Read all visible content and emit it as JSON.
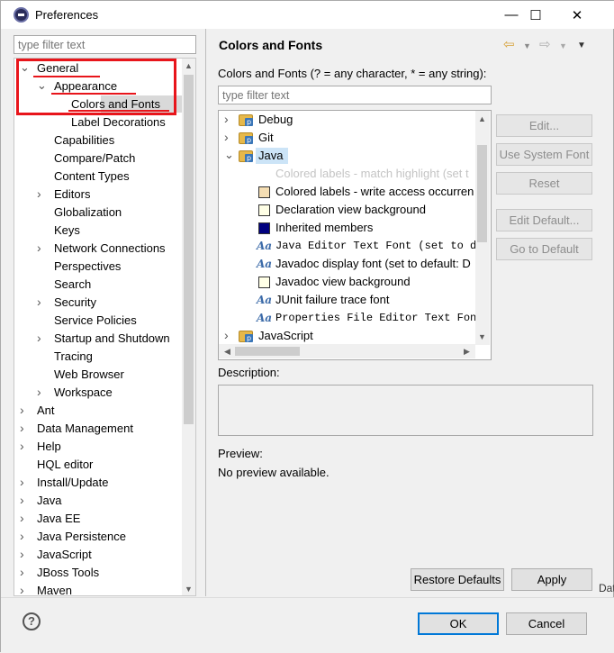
{
  "window": {
    "title": "Preferences",
    "minimize": "—",
    "maximize": "☐",
    "close": "✕"
  },
  "left": {
    "filter_placeholder": "type filter text",
    "tree": [
      {
        "label": "General",
        "indent": 0,
        "expander": "v",
        "id": "general"
      },
      {
        "label": "Appearance",
        "indent": 1,
        "expander": "v",
        "id": "appearance"
      },
      {
        "label": "Colors and Fonts",
        "indent": 2,
        "expander": "",
        "id": "colors-and-fonts",
        "selected": true
      },
      {
        "label": "Label Decorations",
        "indent": 2,
        "expander": "",
        "id": "label-decorations"
      },
      {
        "label": "Capabilities",
        "indent": 1,
        "expander": "",
        "id": "capabilities"
      },
      {
        "label": "Compare/Patch",
        "indent": 1,
        "expander": "",
        "id": "compare-patch"
      },
      {
        "label": "Content Types",
        "indent": 1,
        "expander": "",
        "id": "content-types"
      },
      {
        "label": "Editors",
        "indent": 1,
        "expander": ">",
        "id": "editors"
      },
      {
        "label": "Globalization",
        "indent": 1,
        "expander": "",
        "id": "globalization"
      },
      {
        "label": "Keys",
        "indent": 1,
        "expander": "",
        "id": "keys"
      },
      {
        "label": "Network Connections",
        "indent": 1,
        "expander": ">",
        "id": "network-connections"
      },
      {
        "label": "Perspectives",
        "indent": 1,
        "expander": "",
        "id": "perspectives"
      },
      {
        "label": "Search",
        "indent": 1,
        "expander": "",
        "id": "search"
      },
      {
        "label": "Security",
        "indent": 1,
        "expander": ">",
        "id": "security"
      },
      {
        "label": "Service Policies",
        "indent": 1,
        "expander": "",
        "id": "service-policies"
      },
      {
        "label": "Startup and Shutdown",
        "indent": 1,
        "expander": ">",
        "id": "startup-and-shutdown"
      },
      {
        "label": "Tracing",
        "indent": 1,
        "expander": "",
        "id": "tracing"
      },
      {
        "label": "Web Browser",
        "indent": 1,
        "expander": "",
        "id": "web-browser"
      },
      {
        "label": "Workspace",
        "indent": 1,
        "expander": ">",
        "id": "workspace"
      },
      {
        "label": "Ant",
        "indent": 0,
        "expander": ">",
        "id": "ant"
      },
      {
        "label": "Data Management",
        "indent": 0,
        "expander": ">",
        "id": "data-management"
      },
      {
        "label": "Help",
        "indent": 0,
        "expander": ">",
        "id": "help"
      },
      {
        "label": "HQL editor",
        "indent": 0,
        "expander": "",
        "id": "hql-editor"
      },
      {
        "label": "Install/Update",
        "indent": 0,
        "expander": ">",
        "id": "install-update"
      },
      {
        "label": "Java",
        "indent": 0,
        "expander": ">",
        "id": "java"
      },
      {
        "label": "Java EE",
        "indent": 0,
        "expander": ">",
        "id": "java-ee"
      },
      {
        "label": "Java Persistence",
        "indent": 0,
        "expander": ">",
        "id": "java-persistence"
      },
      {
        "label": "JavaScript",
        "indent": 0,
        "expander": ">",
        "id": "javascript"
      },
      {
        "label": "JBoss Tools",
        "indent": 0,
        "expander": ">",
        "id": "jboss-tools"
      },
      {
        "label": "Maven",
        "indent": 0,
        "expander": ">",
        "id": "maven"
      }
    ]
  },
  "right": {
    "title": "Colors and Fonts",
    "hint": "Colors and Fonts (? = any character, * = any string):",
    "filter_placeholder": "type filter text",
    "tree": [
      {
        "label": "Debug",
        "indent": 0,
        "expander": ">",
        "icon": "folder",
        "id": "debug"
      },
      {
        "label": "Git",
        "indent": 0,
        "expander": ">",
        "icon": "folder",
        "id": "git"
      },
      {
        "label": "Java",
        "indent": 0,
        "expander": "v",
        "icon": "folder",
        "id": "java",
        "highlight": true
      },
      {
        "label": "Colored labels - match highlight (set t",
        "indent": 1,
        "expander": "",
        "icon": "none",
        "id": "colored-labels-match",
        "dim": true
      },
      {
        "label": "Colored labels - write access occurren",
        "indent": 1,
        "expander": "",
        "icon": "swatch",
        "color": "#f5deb3",
        "id": "colored-labels-write"
      },
      {
        "label": "Declaration view background",
        "indent": 1,
        "expander": "",
        "icon": "swatch",
        "color": "#ffffe6",
        "id": "declaration-view-bg"
      },
      {
        "label": "Inherited members",
        "indent": 1,
        "expander": "",
        "icon": "swatch",
        "color": "#00007f",
        "id": "inherited-members"
      },
      {
        "label": "Java Editor Text Font (set to de",
        "indent": 1,
        "expander": "",
        "icon": "font",
        "mono": true,
        "id": "java-editor-text-font"
      },
      {
        "label": "Javadoc display font (set to default: D",
        "indent": 1,
        "expander": "",
        "icon": "font",
        "id": "javadoc-display-font"
      },
      {
        "label": "Javadoc view background",
        "indent": 1,
        "expander": "",
        "icon": "swatch",
        "color": "#ffffe6",
        "id": "javadoc-view-bg"
      },
      {
        "label": "JUnit failure trace font",
        "indent": 1,
        "expander": "",
        "icon": "font",
        "id": "junit-failure-trace-font"
      },
      {
        "label": "Properties File Editor Text Font",
        "indent": 1,
        "expander": "",
        "icon": "font",
        "mono": true,
        "id": "properties-file-editor-font"
      },
      {
        "label": "JavaScript",
        "indent": 0,
        "expander": ">",
        "icon": "folder",
        "id": "javascript"
      }
    ],
    "buttons": {
      "edit": "Edit...",
      "use_system_font": "Use System Font",
      "reset": "Reset",
      "edit_default": "Edit Default...",
      "go_to_default": "Go to Default"
    },
    "description_label": "Description:",
    "preview_label": "Preview:",
    "preview_text": "No preview available.",
    "restore_defaults": "Restore Defaults",
    "apply": "Apply"
  },
  "footer": {
    "ok": "OK",
    "cancel": "Cancel",
    "help": "?"
  },
  "edge_text": "Data"
}
